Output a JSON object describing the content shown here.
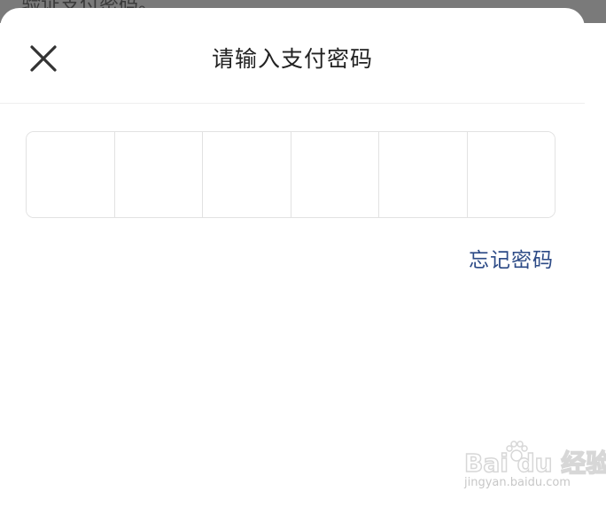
{
  "backdrop": {
    "text": "验证支付密码。"
  },
  "header": {
    "title": "请输入支付密码"
  },
  "pin": {
    "cells": [
      "",
      "",
      "",
      "",
      "",
      ""
    ]
  },
  "links": {
    "forgot_password": "忘记密码"
  },
  "watermark": {
    "logo": "Bai du 经验",
    "url": "jingyan.baidu.com"
  },
  "colors": {
    "link": "#2c4a86",
    "title": "#222222",
    "cell_border": "#e2e2e2",
    "backdrop": "#7a7a7a"
  },
  "icons": {
    "close": "close-icon",
    "watermark_paw": "paw-icon"
  }
}
